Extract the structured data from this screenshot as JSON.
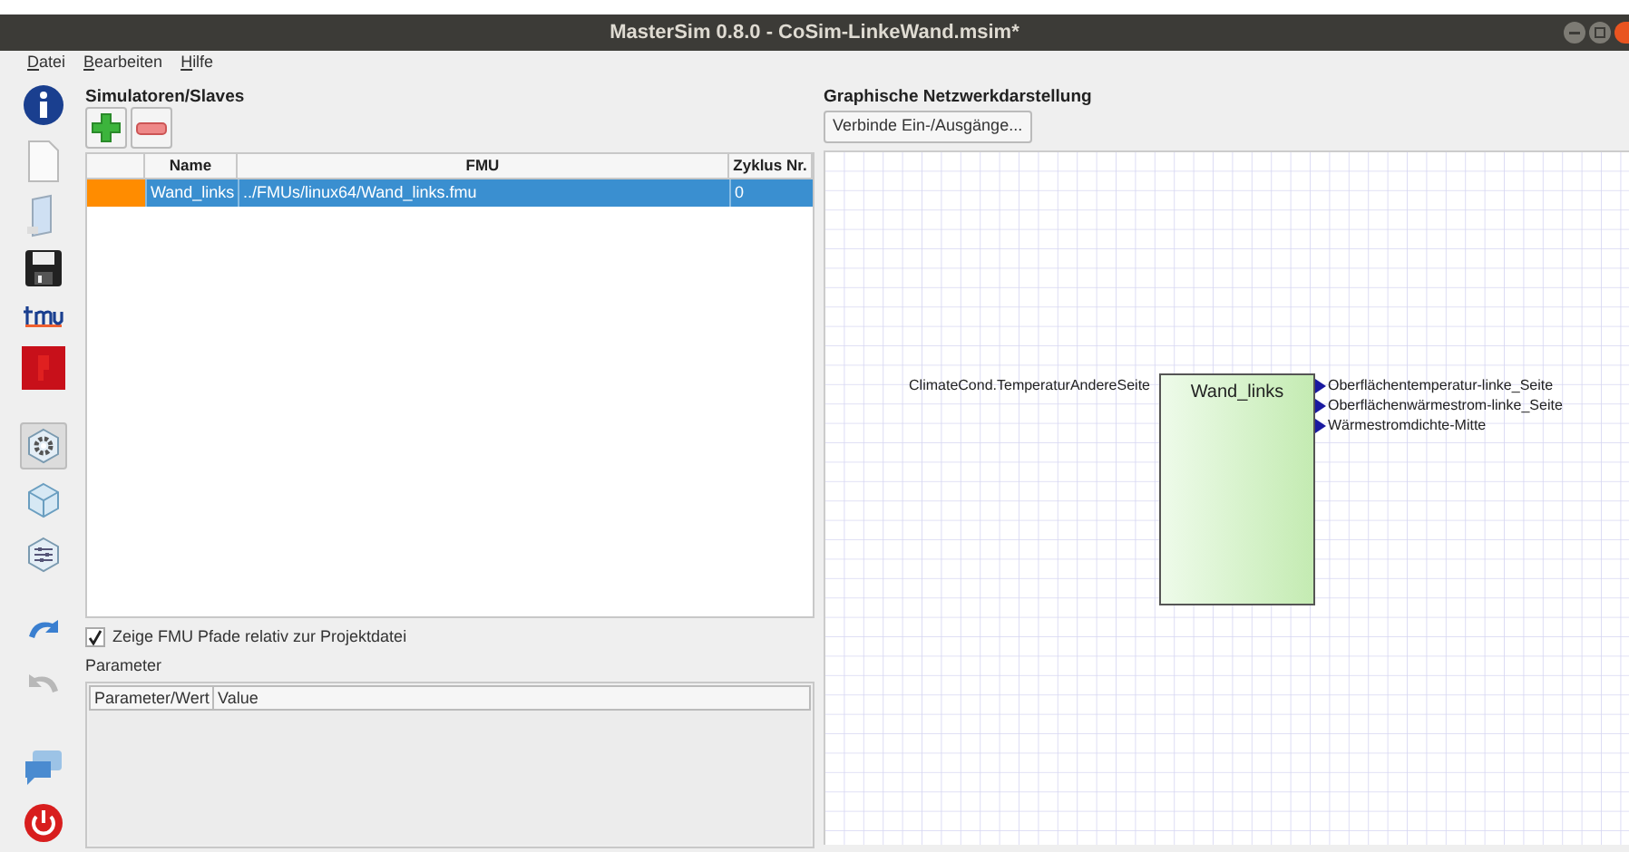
{
  "window": {
    "title": "MasterSim 0.8.0 - CoSim-LinkeWand.msim*"
  },
  "menu": [
    "Datei",
    "Bearbeiten",
    "Hilfe"
  ],
  "views": [
    {
      "selected": true
    },
    {
      "selected": false
    },
    {
      "selected": false
    }
  ],
  "history": [
    {
      "disabled": false
    },
    {
      "disabled": true
    }
  ],
  "simulators": {
    "title": "Simulatoren/Slaves",
    "columns": [
      "Name",
      "FMU",
      "Zyklus Nr."
    ],
    "rows": [
      {
        "color": "#ff8c00",
        "name": "Wand_links",
        "fmu": "../FMUs/linux64/Wand_links.fmu",
        "cycle": "0",
        "selected": true
      }
    ]
  },
  "relative_paths": {
    "label": "Zeige FMU Pfade relativ zur Projektdatei",
    "checked": true
  },
  "parameters": {
    "title": "Parameter",
    "columns": [
      "Parameter/Wert",
      "Value"
    ]
  },
  "network": {
    "title": "Graphische Netzwerkdarstellung",
    "button": "Verbinde Ein-/Ausgänge...",
    "block": {
      "name": "Wand_links",
      "inputs": [
        "ClimateCond.TemperaturAndereSeite"
      ],
      "outputs": [
        "Oberflächentemperatur-linke_Seite",
        "Oberflächenwärmestrom-linke_Seite",
        "Wärmestromdichte-Mitte"
      ]
    }
  }
}
